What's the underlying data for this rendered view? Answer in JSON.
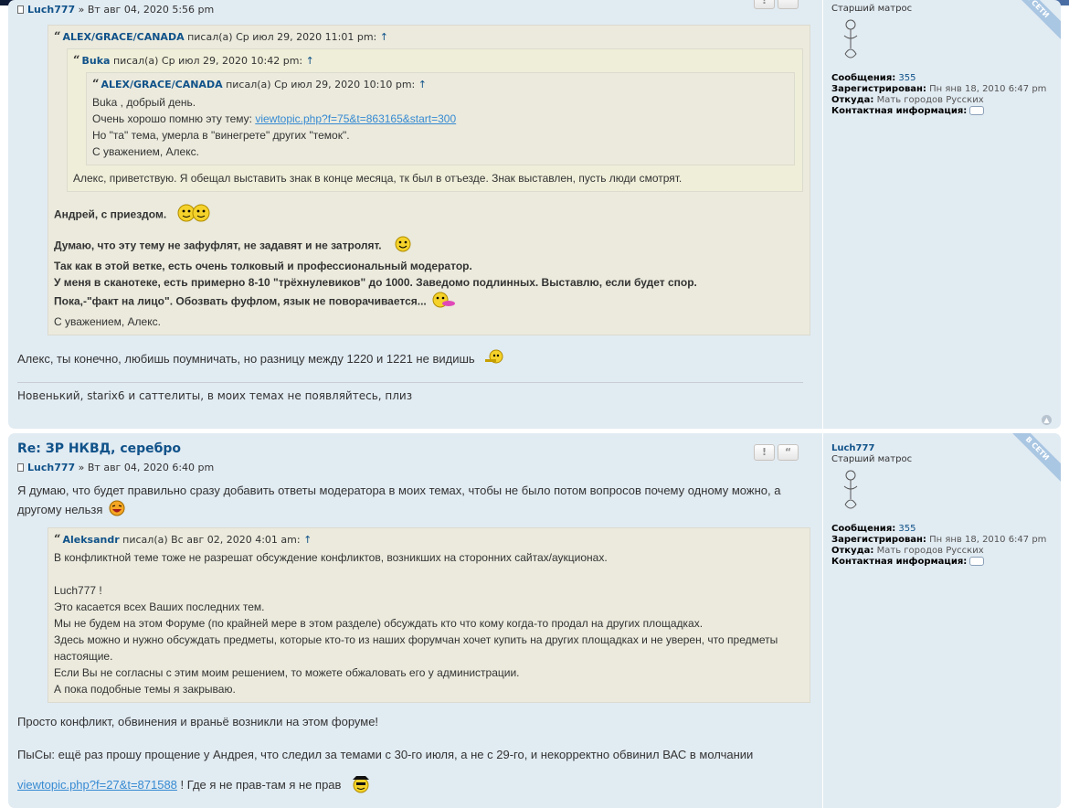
{
  "post1": {
    "author": "Luch777",
    "date": "» Вт авг 04, 2020 5:56 pm",
    "quote_outer": {
      "author": "ALEX/GRACE/CANADA",
      "meta": "писал(а) Ср июл 29, 2020 11:01 pm:",
      "quote_mid": {
        "author": "Buka",
        "meta": "писал(а) Ср июл 29, 2020 10:42 pm:",
        "quote_inner": {
          "author": "ALEX/GRACE/CANADA",
          "meta": "писал(а) Ср июл 29, 2020 10:10 pm:",
          "line1": "Buka , добрый день.",
          "line2_text": "Очень хорошо помню эту тему:",
          "line2_link": "viewtopic.php?f=75&t=863165&start=300",
          "line3": "Но \"та\" тема, умерла в \"винегрете\" других \"темок\".",
          "line4": "С уважением, Алекс."
        },
        "reply": "Алекс, приветствую. Я обещал выставить знак в конце месяца, тк был в отъезде. Знак выставлен, пусть люди смотрят."
      },
      "line1": "Андрей, с приездом.",
      "line2": "Думаю, что эту тему не зафуфлят, не задавят и не затролят.",
      "line3": "Так как в этой ветке, есть очень толковый и профессиональный модератор.",
      "line4": "У меня в сканотеке, есть примерно 8-10 \"трёхнулевиков\" до 1000. Заведомо подлинных. Выставлю, если будет спор.",
      "line5": "Пока,-\"факт на лицо\". Обозвать фуфлом, язык не поворачивается...",
      "line6": "С уважением, Алекс."
    },
    "reply": "Алекс, ты конечно, любишь поумничать, но разницу между 1220 и 1221 не видишь",
    "signature": "Новенький, starix6 и саттелиты, в моих темах не появляйтесь, плиз"
  },
  "post2": {
    "title": "Re: ЗР НКВД, серебро",
    "author": "Luch777",
    "date": "» Вт авг 04, 2020 6:40 pm",
    "para1": "Я думаю, что будет правильно сразу добавить ответы модератора в моих темах, чтобы не было потом вопросов почему одному можно, а другому нельзя",
    "quote": {
      "author": "Aleksandr",
      "meta": "писал(а) Вс авг 02, 2020 4:01 am:",
      "line1": "В конфликтной теме тоже не разрешат обсуждение конфликтов, возникших на сторонних сайтах/аукционах.",
      "line2": "Luch777 !",
      "line3": "Это касается всех Ваших последних тем.",
      "line4": "Мы не будем на этом Форуме (по крайней мере в этом разделе) обсуждать кто что кому когда-то продал на других площадках.",
      "line5": "Здесь можно и нужно обсуждать предметы, которые кто-то из наших форумчан хочет купить на других площадках и не уверен, что предметы настоящие.",
      "line6": "Если Вы не согласны с этим моим решением, то можете обжаловать его у администрации.",
      "line7": "А пока подобные темы я закрываю."
    },
    "para2": "Просто конфликт, обвинения и враньё возникли на этом форуме!",
    "para3": "ПыСы: ещё раз прошу прощение у Андрея, что следил за темами с 30-го июля, а не с 29-го, и некорректно обвинил ВАС в молчании",
    "link": "viewtopic.php?f=27&t=871588",
    "link_tail": "! Где я не прав-там я не прав"
  },
  "profile": {
    "username": "Luch777",
    "rank": "Старший матрос",
    "online_badge": "В СЕТИ",
    "messages_label": "Сообщения:",
    "messages_value": "355",
    "registered_label": "Зарегистрирован:",
    "registered_value": "Пн янв 18, 2010 6:47 pm",
    "from_label": "Откуда:",
    "from_value": "Мать городов Русских",
    "contact_label": "Контактная информация:"
  },
  "buttons": {
    "report": "!",
    "quote": "66"
  },
  "colors": {
    "post_bg": "#e1ebf2",
    "quote_bg": "#ebeadd",
    "link": "#105289",
    "accent_link": "#368ad2"
  }
}
